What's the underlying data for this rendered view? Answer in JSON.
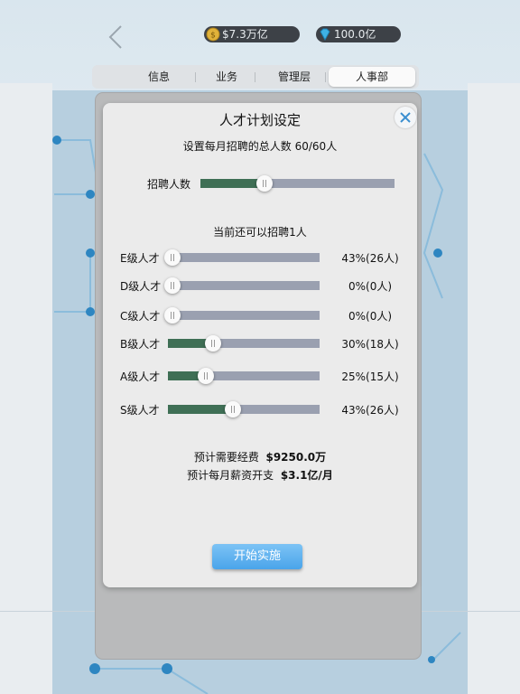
{
  "header": {
    "gold": "$7.3万亿",
    "gems": "100.0亿"
  },
  "tabs": [
    {
      "label": "信息",
      "active": false
    },
    {
      "label": "业务",
      "active": false
    },
    {
      "label": "管理层",
      "active": false
    },
    {
      "label": "人事部",
      "active": true
    }
  ],
  "dialog": {
    "title": "人才计划设定",
    "subtitle": "设置每月招聘的总人数 60/60人",
    "recruit": {
      "label": "招聘人数",
      "fraction": 0.33
    },
    "remaining": "当前还可以招聘1人",
    "levels": [
      {
        "label": "E级人才",
        "fraction": 0.0,
        "value": "43%(26人)"
      },
      {
        "label": "D级人才",
        "fraction": 0.0,
        "value": "0%(0人)"
      },
      {
        "label": "C级人才",
        "fraction": 0.0,
        "value": "0%(0人)"
      },
      {
        "label": "B级人才",
        "fraction": 0.3,
        "value": "30%(18人)"
      },
      {
        "label": "A级人才",
        "fraction": 0.25,
        "value": "25%(15人)"
      },
      {
        "label": "S级人才",
        "fraction": 0.43,
        "value": "43%(26人)"
      }
    ],
    "cost_label": "预计需要经费",
    "cost_value": "$9250.0万",
    "salary_label": "预计每月薪资开支",
    "salary_value": "$3.1亿/月",
    "start_button": "开始实施"
  },
  "colors": {
    "fill": "#3f6f55",
    "track": "#9aa0b0",
    "button": "#4aa4ea"
  }
}
